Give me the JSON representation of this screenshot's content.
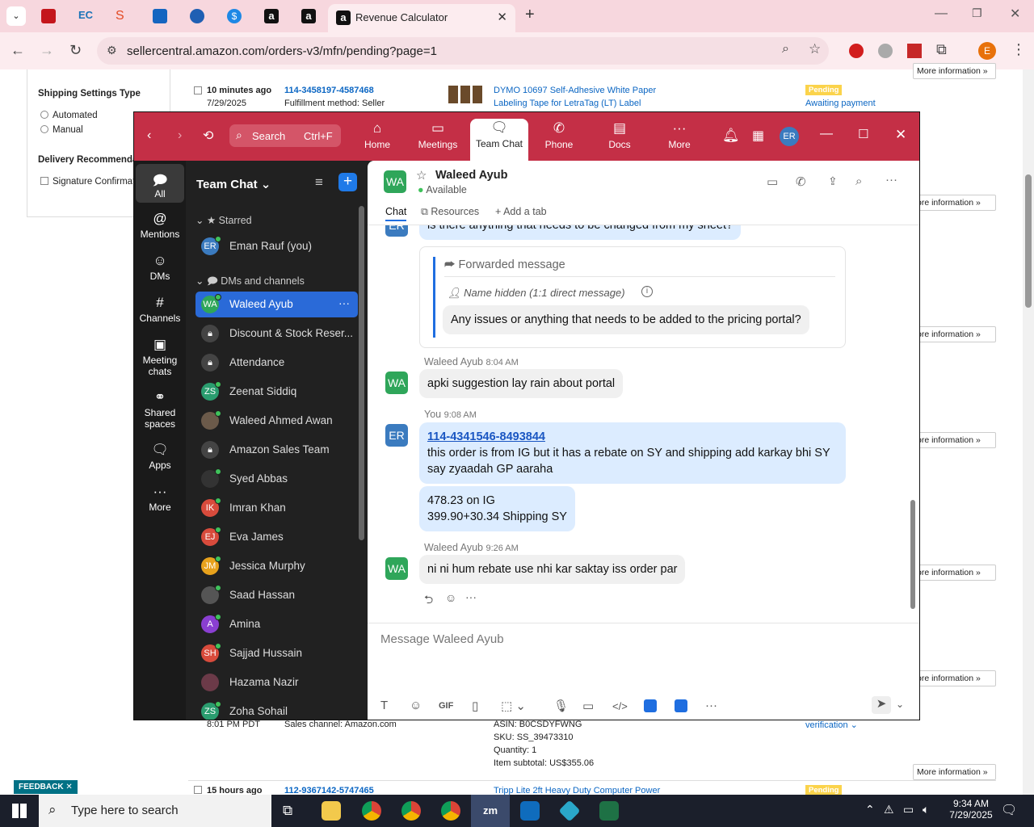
{
  "browser": {
    "active_tab_title": "Revenue Calculator",
    "url": "sellercentral.amazon.com/orders-v3/mfn/pending?page=1",
    "profile_initial": "E"
  },
  "seller": {
    "shipping_settings_title": "Shipping Settings Type",
    "opt_automated": "Automated",
    "opt_manual": "Manual",
    "delivery_title": "Delivery Recommenda",
    "signature": "Signature Confirmat",
    "order1_time": "10 minutes ago",
    "order1_date": "7/29/2025",
    "order1_id": "114-3458197-4587468",
    "order1_fulfill": "Fulfillment method: Seller",
    "order1_product": "DYMO 10697 Self-Adhesive White Paper",
    "order1_product2": "Labeling Tape for LetraTag (LT) Label",
    "pending": "Pending",
    "awaiting": "Awaiting payment",
    "more_info": "More information",
    "more_info_cut": "ore information",
    "order2_time": "8:01 PM PDT",
    "order2_channel": "Sales channel: Amazon.com",
    "asin": "ASIN: B0CSDYFWNG",
    "sku": "SKU: SS_39473310",
    "qty": "Quantity: 1",
    "subtotal": "Item subtotal: US$355.06",
    "verification": "verification",
    "order3_time": "15 hours ago",
    "order3_id": "112-9367142-5747465",
    "order3_product": "Tripp Lite 2ft Heavy Duty Computer Power",
    "feedback": "FEEDBACK"
  },
  "zoom": {
    "search_label": "Search",
    "search_shortcut": "Ctrl+F",
    "nav": [
      "Home",
      "Meetings",
      "Team Chat",
      "Phone",
      "Docs",
      "More"
    ],
    "user_initials": "ER",
    "rail": [
      "All",
      "Mentions",
      "DMs",
      "Channels",
      "Meeting chats",
      "Shared spaces",
      "Apps",
      "More"
    ],
    "sidebar_title": "Team Chat",
    "starred": "Starred",
    "dms_channels": "DMs and channels",
    "contacts": [
      {
        "name": "Eman Rauf (you)",
        "initials": "ER",
        "color": "#3b7bbf"
      },
      {
        "name": "Waleed Ayub",
        "initials": "WA",
        "color": "#2fa65a"
      },
      {
        "name": "Discount & Stock Reser...",
        "initials": "",
        "color": "#444"
      },
      {
        "name": "Attendance",
        "initials": "",
        "color": "#444"
      },
      {
        "name": "Zeenat Siddiq",
        "initials": "ZS",
        "color": "#2a9d6f"
      },
      {
        "name": "Waleed Ahmed Awan",
        "initials": "",
        "color": "#6b5a4a"
      },
      {
        "name": "Amazon Sales Team",
        "initials": "",
        "color": "#444"
      },
      {
        "name": "Syed Abbas",
        "initials": "",
        "color": "#333"
      },
      {
        "name": "Imran Khan",
        "initials": "IK",
        "color": "#d84b3c"
      },
      {
        "name": "Eva James",
        "initials": "EJ",
        "color": "#d84b3c"
      },
      {
        "name": "Jessica Murphy",
        "initials": "JM",
        "color": "#e8a21c"
      },
      {
        "name": "Saad Hassan",
        "initials": "",
        "color": "#555"
      },
      {
        "name": "Amina",
        "initials": "A",
        "color": "#8a3fd1"
      },
      {
        "name": "Sajjad Hussain",
        "initials": "SH",
        "color": "#d84b3c"
      },
      {
        "name": "Hazama Nazir",
        "initials": "",
        "color": "#6b3a48"
      },
      {
        "name": "Zoha Sohail",
        "initials": "ZS",
        "color": "#2a9d6f"
      }
    ],
    "chat_name": "Waleed Ayub",
    "chat_initials": "WA",
    "status": "Available",
    "tab_chat": "Chat",
    "tab_resources": "Resources",
    "tab_add": "Add a tab",
    "msg_top": "is there anything that needs to be changed from my sheet?",
    "fwd_title": "Forwarded message",
    "fwd_from": "Name hidden (1:1 direct message)",
    "fwd_text": "Any issues or anything that needs to be added to the pricing portal?",
    "sender1": "Waleed Ayub",
    "time1": "8:04 AM",
    "msg1": "apki suggestion lay rain about portal",
    "sender2": "You",
    "time2": "9:08 AM",
    "msg2_link": "114-4341546-8493844",
    "msg2_text": "this order is from IG but it has a rebate on SY and shipping add karkay bhi SY say zyaadah GP aaraha",
    "msg3_line1": "478.23 on IG",
    "msg3_line2": "399.90+30.34 Shipping SY",
    "sender3": "Waleed Ayub",
    "time3": "9:26 AM",
    "msg4": "ni ni hum rebate use nhi kar saktay iss order par",
    "placeholder": "Message Waleed Ayub"
  },
  "taskbar": {
    "search": "Type here to search",
    "time": "9:34 AM",
    "date": "7/29/2025"
  }
}
